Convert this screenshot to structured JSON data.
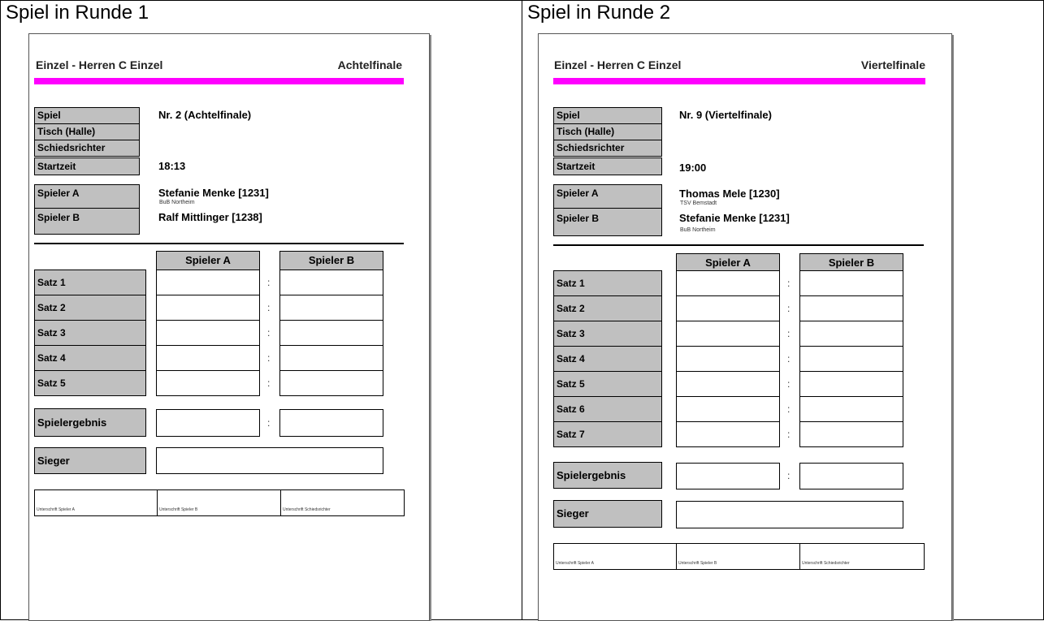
{
  "panels": [
    {
      "title": "Spiel in Runde 1",
      "header_left": "Einzel - Herren C Einzel",
      "header_right": "Achtelfinale",
      "info_labels": [
        "Spiel",
        "Tisch (Halle)",
        "Schiedsrichter",
        "Startzeit"
      ],
      "spiel_value": "Nr. 2 (Achtelfinale)",
      "startzeit_value": "18:13",
      "spieler_a_label": "Spieler A",
      "spieler_b_label": "Spieler B",
      "spieler_a_name": "Stefanie Menke [1231]",
      "spieler_a_club": "BuB Northeim",
      "spieler_b_name": "Ralf Mittlinger [1238]",
      "spieler_b_club": "",
      "col_a": "Spieler A",
      "col_b": "Spieler B",
      "sets": [
        "Satz 1",
        "Satz 2",
        "Satz 3",
        "Satz 4",
        "Satz 5"
      ],
      "colon": ":",
      "result_label": "Spielergebnis",
      "winner_label": "Sieger",
      "signatures": [
        "Unterschrift Spieler A",
        "Unterschrift Spieler B",
        "Unterschrift Schiedsrichter"
      ]
    },
    {
      "title": "Spiel in Runde 2",
      "header_left": "Einzel - Herren C Einzel",
      "header_right": "Viertelfinale",
      "info_labels": [
        "Spiel",
        "Tisch (Halle)",
        "Schiedsrichter",
        "Startzeit"
      ],
      "spiel_value": "Nr. 9 (Viertelfinale)",
      "startzeit_value": "19:00",
      "spieler_a_label": "Spieler A",
      "spieler_b_label": "Spieler B",
      "spieler_a_name": "Thomas Mele [1230]",
      "spieler_a_club": "TSV Bemstadt",
      "spieler_b_name": "Stefanie Menke [1231]",
      "spieler_b_club": "BuB Northeim",
      "col_a": "Spieler A",
      "col_b": "Spieler B",
      "sets": [
        "Satz 1",
        "Satz 2",
        "Satz 3",
        "Satz 4",
        "Satz 5",
        "Satz 6",
        "Satz 7"
      ],
      "colon": ":",
      "result_label": "Spielergebnis",
      "winner_label": "Sieger",
      "signatures": [
        "Unterschrift Spieler A",
        "Unterschrift Spieler B",
        "Unterschrift Schiedsrichter"
      ]
    }
  ]
}
